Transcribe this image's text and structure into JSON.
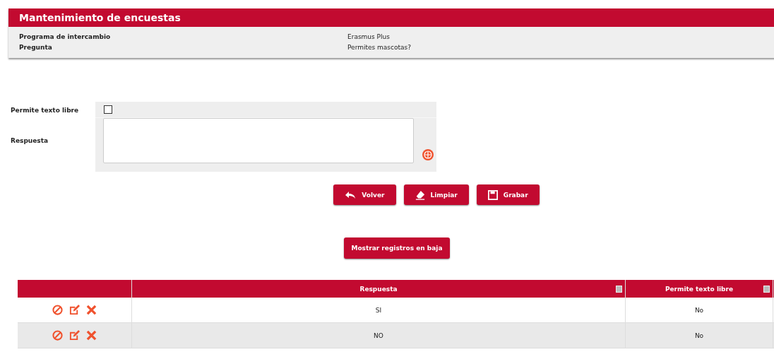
{
  "panel": {
    "title": "Mantenimiento de encuestas",
    "fields": [
      {
        "label": "Programa de intercambio",
        "value": "Erasmus Plus"
      },
      {
        "label": "Pregunta",
        "value": "Permites mascotas?"
      }
    ]
  },
  "form": {
    "free_text_label": "Permite texto libre",
    "free_text_checked": false,
    "answer_label": "Respuesta"
  },
  "buttons": [
    {
      "kind": "back",
      "label": "Volver"
    },
    {
      "kind": "clear",
      "label": "Limpiar"
    },
    {
      "kind": "save",
      "label": "Grabar"
    }
  ],
  "show_deleted_button": "Mostrar registros en baja",
  "table": {
    "columns": [
      "Respuesta",
      "Permite texto libre"
    ],
    "rows": [
      {
        "respuesta": "SI",
        "permite_texto_libre": "No"
      },
      {
        "respuesta": "NO",
        "permite_texto_libre": "No"
      }
    ]
  }
}
